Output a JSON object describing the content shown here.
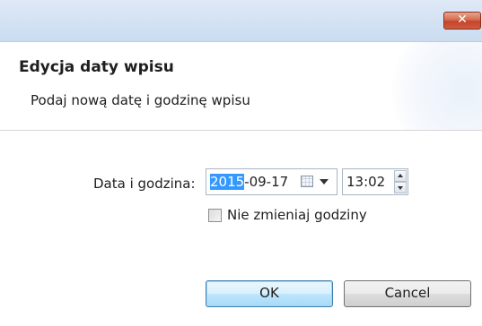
{
  "window": {
    "close_glyph": "✕"
  },
  "header": {
    "title": "Edycja daty wpisu",
    "subtitle": "Podaj nową datę i godzinę wpisu"
  },
  "form": {
    "datetime_label": "Data i godzina:",
    "date_value_selected": "2015",
    "date_value_rest": "-09-17",
    "calendar_icon": "calendar-icon",
    "time_value": "13:02",
    "keep_time_checkbox": {
      "label": "Nie zmieniaj godziny",
      "checked": false
    }
  },
  "buttons": {
    "ok": "OK",
    "cancel": "Cancel"
  }
}
